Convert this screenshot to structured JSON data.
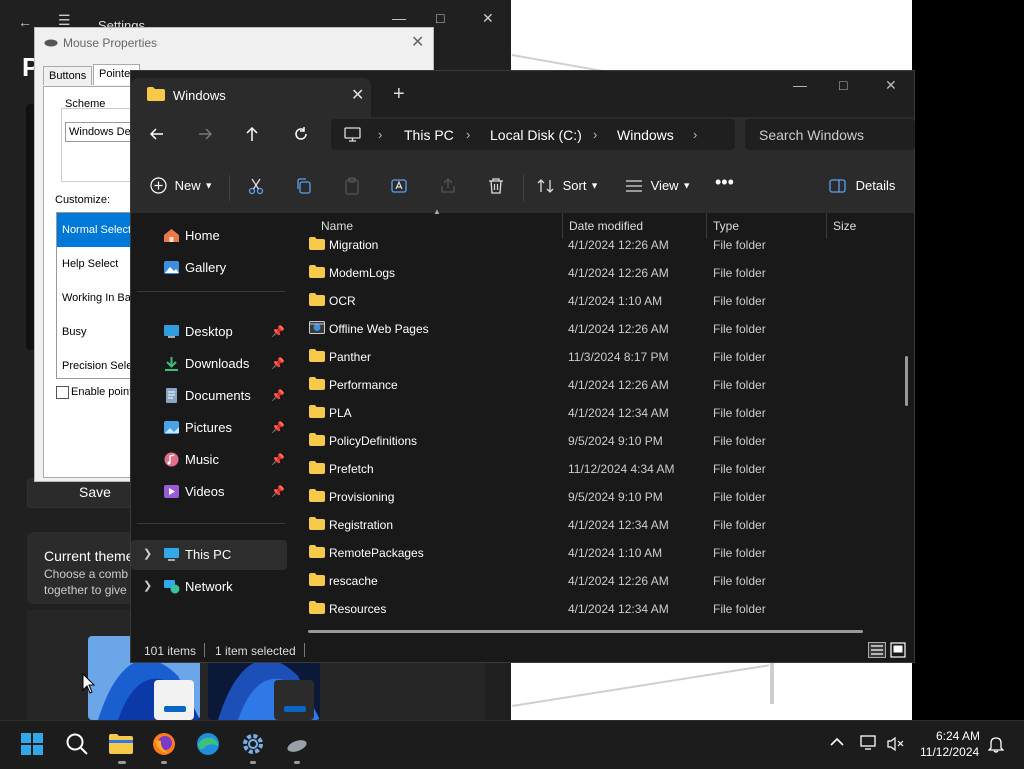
{
  "colors": {
    "accent": "#0078d7",
    "folder": "#f7c948",
    "explorer_bg": "#191919",
    "taskbar_bg": "#1c1c1c"
  },
  "settings": {
    "title": "Settings",
    "header_letter": "P",
    "save_label": "Save",
    "theme_title": "Current theme",
    "theme_desc_line1": "Choose a comb",
    "theme_desc_line2": "together to give"
  },
  "mouse_dialog": {
    "title": "Mouse Properties",
    "tabs": [
      "Buttons",
      "Pointer"
    ],
    "scheme_label": "Scheme",
    "scheme_value": "Windows Def",
    "customize_label": "Customize:",
    "cursor_list": [
      "Normal Select",
      "Help Select",
      "Working In Ba",
      "Busy",
      "Precision Sele"
    ],
    "selected_cursor_index": 0,
    "enable_checkbox_label": "Enable point"
  },
  "explorer": {
    "tab_title": "Windows",
    "breadcrumb": [
      "This PC",
      "Local Disk (C:)",
      "Windows"
    ],
    "search_placeholder": "Search Windows",
    "toolbar": {
      "new_label": "New",
      "sort_label": "Sort",
      "view_label": "View",
      "details_label": "Details"
    },
    "nav": {
      "home": "Home",
      "gallery": "Gallery",
      "desktop": "Desktop",
      "downloads": "Downloads",
      "documents": "Documents",
      "pictures": "Pictures",
      "music": "Music",
      "videos": "Videos",
      "this_pc": "This PC",
      "network": "Network"
    },
    "columns": {
      "name": "Name",
      "date": "Date modified",
      "type": "Type",
      "size": "Size"
    },
    "rows": [
      {
        "name": "Migration",
        "date": "4/1/2024 12:26 AM",
        "type": "File folder",
        "icon": "folder"
      },
      {
        "name": "ModemLogs",
        "date": "4/1/2024 12:26 AM",
        "type": "File folder",
        "icon": "folder"
      },
      {
        "name": "OCR",
        "date": "4/1/2024 1:10 AM",
        "type": "File folder",
        "icon": "folder"
      },
      {
        "name": "Offline Web Pages",
        "date": "4/1/2024 12:26 AM",
        "type": "File folder",
        "icon": "special-folder"
      },
      {
        "name": "Panther",
        "date": "11/3/2024 8:17 PM",
        "type": "File folder",
        "icon": "folder"
      },
      {
        "name": "Performance",
        "date": "4/1/2024 12:26 AM",
        "type": "File folder",
        "icon": "folder"
      },
      {
        "name": "PLA",
        "date": "4/1/2024 12:34 AM",
        "type": "File folder",
        "icon": "folder"
      },
      {
        "name": "PolicyDefinitions",
        "date": "9/5/2024 9:10 PM",
        "type": "File folder",
        "icon": "folder"
      },
      {
        "name": "Prefetch",
        "date": "11/12/2024 4:34 AM",
        "type": "File folder",
        "icon": "folder"
      },
      {
        "name": "Provisioning",
        "date": "9/5/2024 9:10 PM",
        "type": "File folder",
        "icon": "folder"
      },
      {
        "name": "Registration",
        "date": "4/1/2024 12:34 AM",
        "type": "File folder",
        "icon": "folder"
      },
      {
        "name": "RemotePackages",
        "date": "4/1/2024 1:10 AM",
        "type": "File folder",
        "icon": "folder"
      },
      {
        "name": "rescache",
        "date": "4/1/2024 12:26 AM",
        "type": "File folder",
        "icon": "folder"
      },
      {
        "name": "Resources",
        "date": "4/1/2024 12:34 AM",
        "type": "File folder",
        "icon": "folder"
      }
    ],
    "status_items": "101 items",
    "status_selected": "1 item selected"
  },
  "taskbar": {
    "time": "6:24 AM",
    "date": "11/12/2024"
  }
}
